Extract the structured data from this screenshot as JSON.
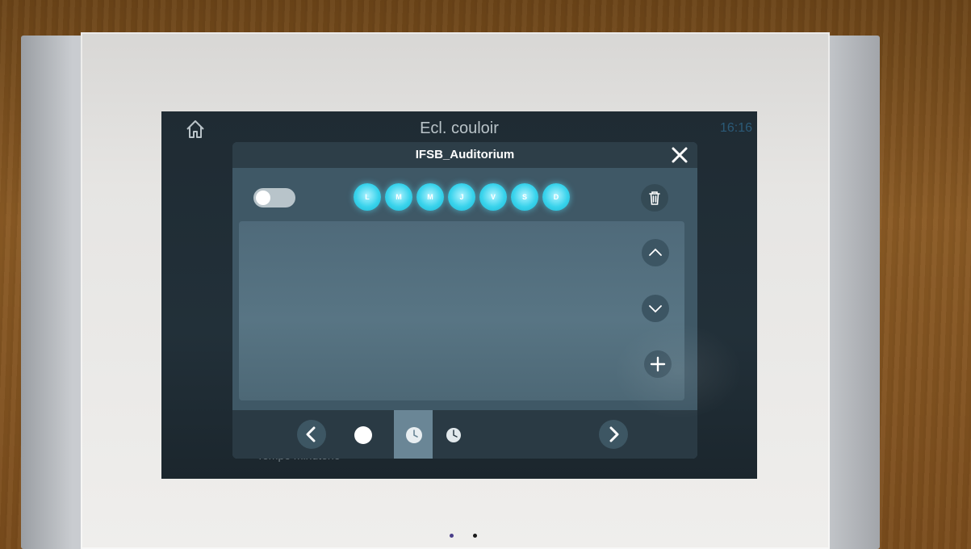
{
  "screen": {
    "title": "Ecl. couloir",
    "clock": "16:16",
    "background_text": "Tempo minuterie",
    "home_icon": "home-icon"
  },
  "dialog": {
    "title": "IFSB_Auditorium",
    "close_icon": "close-icon",
    "enabled": false,
    "days": [
      "L",
      "M",
      "M",
      "J",
      "V",
      "S",
      "D"
    ],
    "trash_icon": "trash-icon",
    "scroll_up_icon": "chevron-up-icon",
    "scroll_down_icon": "chevron-down-icon",
    "add_icon": "plus-icon"
  },
  "footer": {
    "prev_icon": "chevron-left-icon",
    "next_icon": "chevron-right-icon",
    "tabs": [
      {
        "icon": "dot-icon",
        "selected": false
      },
      {
        "icon": "clock-icon",
        "selected": true
      },
      {
        "icon": "clock-icon",
        "selected": false
      }
    ]
  },
  "colors": {
    "accent": "#39d3ec",
    "dialog_bg": "#3f5866",
    "screen_bg": "#1f2b33"
  }
}
